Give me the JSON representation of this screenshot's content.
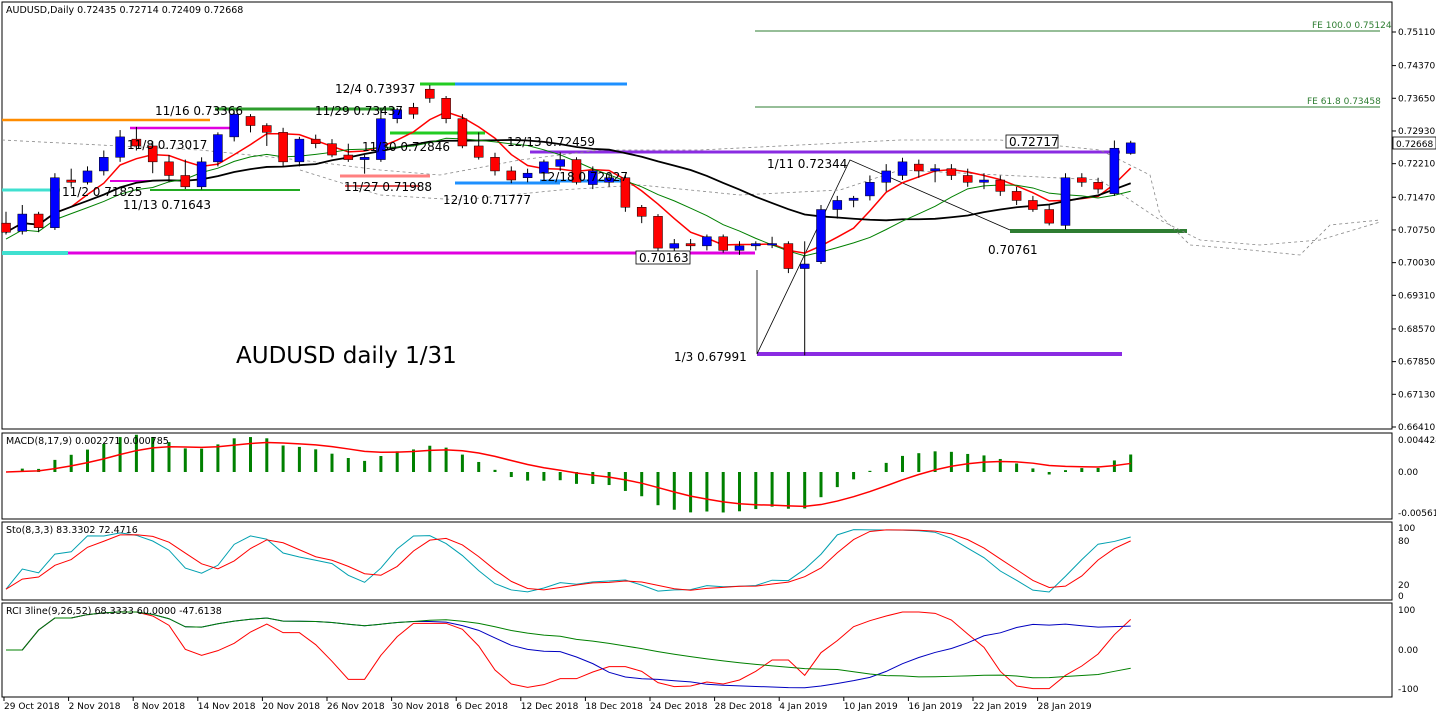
{
  "header": {
    "main": "AUDUSD,Daily  0.72435 0.72714 0.72409 0.72668",
    "macd": "MACD(8,17,9) 0.002271 0.000785",
    "sto": "Sto(8,3,3) 83.3302 72.4716",
    "rci": "RCI 3line(9,26,52) 68.3333 60.0000 -47.6138"
  },
  "chart_title": "AUDUSD daily 1/31",
  "current_price_label": "0.72668",
  "fe_labels": {
    "fe100": "FE 100.0    0.75124",
    "fe618": "FE 61.8    0.73458"
  },
  "price_axis": [
    "0.75110",
    "0.74370",
    "0.73650",
    "0.72930",
    "0.72210",
    "0.71470",
    "0.70750",
    "0.70030",
    "0.69310",
    "0.68570",
    "0.67850",
    "0.67130",
    "0.66410"
  ],
  "macd_axis": [
    "0.004424",
    "0.00",
    "-0.005611"
  ],
  "sto_axis": [
    "100",
    "80",
    "20",
    "0"
  ],
  "rci_axis": [
    "100",
    "0.00",
    "-100"
  ],
  "date_labels": [
    "29 Oct 2018",
    "2 Nov 2018",
    "8 Nov 2018",
    "14 Nov 2018",
    "20 Nov 2018",
    "26 Nov 2018",
    "30 Nov 2018",
    "6 Dec 2018",
    "12 Dec 2018",
    "18 Dec 2018",
    "24 Dec 2018",
    "28 Dec 2018",
    "4 Jan 2019",
    "10 Jan 2019",
    "16 Jan 2019",
    "22 Jan 2019",
    "28 Jan 2019"
  ],
  "annotations": [
    "11/16 0.73366",
    "11/29 0.73437",
    "12/4 0.73937",
    "11/8 0.73017",
    "11/30 0.72846",
    "12/13 0.72459",
    "11/2 0.71825",
    "11/27 0.71988",
    "11/13 0.71643",
    "12/10 0.71777",
    "12/18 0.72027",
    "1/11 0.72344",
    "0.72717",
    "0.70163",
    "0.70761",
    "1/3 0.67991"
  ],
  "colors": {
    "bull": "#0000ff",
    "bear": "#ff0000",
    "sma_black": "#000000",
    "envelope_green": "#008000",
    "macd_hist": "#008000",
    "macd_signal": "#ff0000",
    "sto_main": "#00a0b0",
    "sto_signal": "#ff0000",
    "rci_short": "#ff0000",
    "rci_mid": "#0000c0",
    "rci_long": "#008000"
  },
  "chart_data": {
    "type": "candlestick",
    "instrument": "AUDUSD",
    "timeframe": "Daily",
    "ylim": [
      0.6641,
      0.7511
    ],
    "last": {
      "open": 0.72435,
      "high": 0.72714,
      "low": 0.72409,
      "close": 0.72668
    },
    "ohlc": [
      [
        0.709,
        0.7115,
        0.7065,
        0.707
      ],
      [
        0.7072,
        0.713,
        0.7065,
        0.711
      ],
      [
        0.711,
        0.7115,
        0.707,
        0.708
      ],
      [
        0.708,
        0.72,
        0.7075,
        0.719
      ],
      [
        0.7185,
        0.721,
        0.717,
        0.718
      ],
      [
        0.718,
        0.7215,
        0.7175,
        0.7205
      ],
      [
        0.7205,
        0.725,
        0.7195,
        0.7235
      ],
      [
        0.7235,
        0.7295,
        0.7225,
        0.728
      ],
      [
        0.7275,
        0.7302,
        0.725,
        0.726
      ],
      [
        0.726,
        0.727,
        0.72,
        0.7225
      ],
      [
        0.7225,
        0.724,
        0.718,
        0.7195
      ],
      [
        0.7195,
        0.723,
        0.7165,
        0.717
      ],
      [
        0.717,
        0.7235,
        0.7164,
        0.7225
      ],
      [
        0.7225,
        0.729,
        0.7215,
        0.7285
      ],
      [
        0.728,
        0.7337,
        0.727,
        0.733
      ],
      [
        0.7325,
        0.733,
        0.729,
        0.7305
      ],
      [
        0.7305,
        0.731,
        0.726,
        0.729
      ],
      [
        0.729,
        0.73,
        0.7215,
        0.7225
      ],
      [
        0.7225,
        0.728,
        0.7215,
        0.7275
      ],
      [
        0.7275,
        0.7285,
        0.7255,
        0.7265
      ],
      [
        0.7265,
        0.7275,
        0.7235,
        0.724
      ],
      [
        0.724,
        0.7265,
        0.7225,
        0.723
      ],
      [
        0.723,
        0.724,
        0.7199,
        0.7235
      ],
      [
        0.723,
        0.7344,
        0.7225,
        0.732
      ],
      [
        0.732,
        0.7344,
        0.731,
        0.734
      ],
      [
        0.7345,
        0.7355,
        0.732,
        0.733
      ],
      [
        0.7385,
        0.7394,
        0.7355,
        0.7365
      ],
      [
        0.7365,
        0.737,
        0.731,
        0.732
      ],
      [
        0.732,
        0.733,
        0.7255,
        0.726
      ],
      [
        0.726,
        0.729,
        0.723,
        0.7235
      ],
      [
        0.7235,
        0.7245,
        0.7195,
        0.7205
      ],
      [
        0.7205,
        0.7215,
        0.7178,
        0.7185
      ],
      [
        0.719,
        0.721,
        0.718,
        0.72
      ],
      [
        0.72,
        0.723,
        0.719,
        0.7225
      ],
      [
        0.7215,
        0.7246,
        0.7205,
        0.723
      ],
      [
        0.723,
        0.7235,
        0.7175,
        0.718
      ],
      [
        0.7175,
        0.7215,
        0.7165,
        0.7205
      ],
      [
        0.718,
        0.72,
        0.717,
        0.719
      ],
      [
        0.719,
        0.7195,
        0.7115,
        0.7125
      ],
      [
        0.7125,
        0.713,
        0.709,
        0.7105
      ],
      [
        0.7105,
        0.711,
        0.7025,
        0.7035
      ],
      [
        0.7035,
        0.7055,
        0.7016,
        0.7045
      ],
      [
        0.7045,
        0.7055,
        0.703,
        0.704
      ],
      [
        0.704,
        0.7065,
        0.703,
        0.706
      ],
      [
        0.706,
        0.7065,
        0.7025,
        0.703
      ],
      [
        0.703,
        0.705,
        0.702,
        0.704
      ],
      [
        0.704,
        0.705,
        0.703,
        0.7045
      ],
      [
        0.7045,
        0.706,
        0.7035,
        0.7045
      ],
      [
        0.7045,
        0.705,
        0.698,
        0.699
      ],
      [
        0.699,
        0.705,
        0.6799,
        0.7
      ],
      [
        0.7005,
        0.713,
        0.7,
        0.712
      ],
      [
        0.712,
        0.715,
        0.71,
        0.714
      ],
      [
        0.714,
        0.715,
        0.7125,
        0.7145
      ],
      [
        0.715,
        0.7195,
        0.714,
        0.718
      ],
      [
        0.718,
        0.722,
        0.716,
        0.7205
      ],
      [
        0.7195,
        0.7234,
        0.7185,
        0.7225
      ],
      [
        0.722,
        0.723,
        0.719,
        0.7205
      ],
      [
        0.7205,
        0.722,
        0.718,
        0.721
      ],
      [
        0.721,
        0.722,
        0.7185,
        0.7195
      ],
      [
        0.7195,
        0.721,
        0.717,
        0.718
      ],
      [
        0.718,
        0.72,
        0.7165,
        0.7185
      ],
      [
        0.7185,
        0.7195,
        0.715,
        0.716
      ],
      [
        0.716,
        0.717,
        0.713,
        0.714
      ],
      [
        0.714,
        0.715,
        0.7115,
        0.712
      ],
      [
        0.712,
        0.713,
        0.7085,
        0.709
      ],
      [
        0.7085,
        0.72,
        0.7076,
        0.719
      ],
      [
        0.719,
        0.72,
        0.717,
        0.718
      ],
      [
        0.718,
        0.719,
        0.7155,
        0.7165
      ],
      [
        0.7155,
        0.7272,
        0.715,
        0.7255
      ],
      [
        0.72435,
        0.72714,
        0.72409,
        0.72668
      ]
    ],
    "indicators": [
      "MACD(8,17,9)",
      "Sto(8,3,3)",
      "RCI 3line(9,26,52)"
    ]
  }
}
